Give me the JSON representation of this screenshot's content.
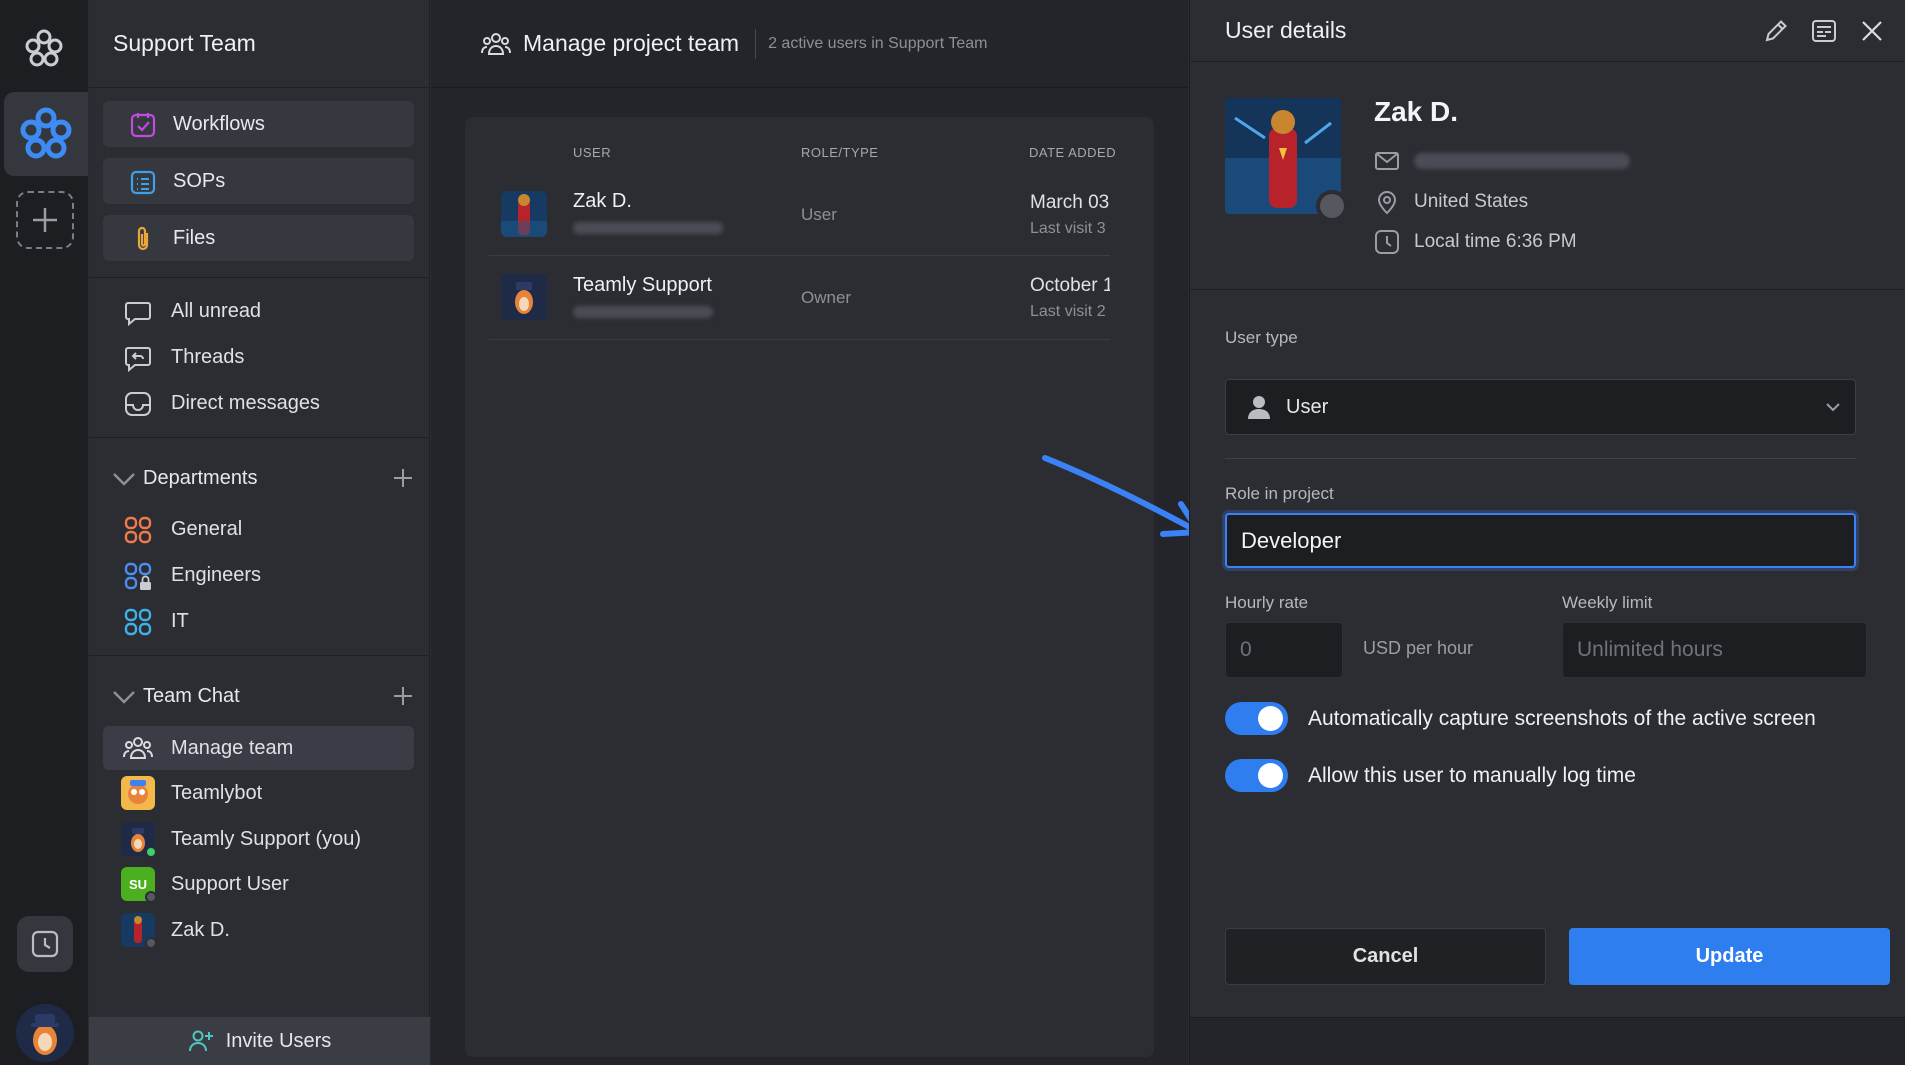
{
  "workspace": {
    "name": "Support Team"
  },
  "sidebar": {
    "pills": [
      {
        "label": "Workflows",
        "icon": "workflow-icon"
      },
      {
        "label": "SOPs",
        "icon": "sop-list-icon"
      },
      {
        "label": "Files",
        "icon": "paperclip-icon"
      }
    ],
    "nav": [
      {
        "label": "All unread",
        "icon": "chat-bubble-icon"
      },
      {
        "label": "Threads",
        "icon": "threads-icon"
      },
      {
        "label": "Direct messages",
        "icon": "inbox-icon"
      }
    ],
    "departments": {
      "title": "Departments",
      "items": [
        {
          "label": "General",
          "color": "#f07a4a"
        },
        {
          "label": "Engineers",
          "color": "#4a8ef0"
        },
        {
          "label": "IT",
          "color": "#3fb0e8"
        }
      ]
    },
    "team_chat": {
      "title": "Team Chat",
      "items": [
        {
          "label": "Manage team"
        },
        {
          "label": "Teamlybot"
        },
        {
          "label": "Teamly Support (you)"
        },
        {
          "label": "Support User",
          "initials": "SU"
        },
        {
          "label": "Zak D."
        }
      ]
    },
    "invite_label": "Invite Users"
  },
  "main": {
    "title": "Manage project team",
    "subtitle": "2 active users in Support Team",
    "columns": {
      "user": "USER",
      "role": "ROLE/TYPE",
      "date": "DATE ADDED"
    },
    "rows": [
      {
        "name": "Zak D.",
        "role": "User",
        "date": "March 03",
        "visit": "Last visit 3"
      },
      {
        "name": "Teamly Support",
        "role": "Owner",
        "date": "October 1",
        "visit": "Last visit 2"
      }
    ]
  },
  "details": {
    "title": "User details",
    "name": "Zak D.",
    "location": "United States",
    "local_time": "Local time 6:36 PM",
    "user_type_label": "User type",
    "user_type_value": "User",
    "role_label": "Role in project",
    "role_value": "Developer",
    "hourly_label": "Hourly rate",
    "hourly_placeholder": "0",
    "usd_label": "USD per hour",
    "weekly_label": "Weekly limit",
    "weekly_placeholder": "Unlimited hours",
    "toggle_screenshots": "Automatically capture screenshots of the active screen",
    "toggle_manual": "Allow this user to manually log time",
    "cancel_label": "Cancel",
    "update_label": "Update"
  },
  "colors": {
    "accent": "#2f7ef0",
    "online": "#3ecf6b",
    "su_badge": "#4caf1f"
  }
}
